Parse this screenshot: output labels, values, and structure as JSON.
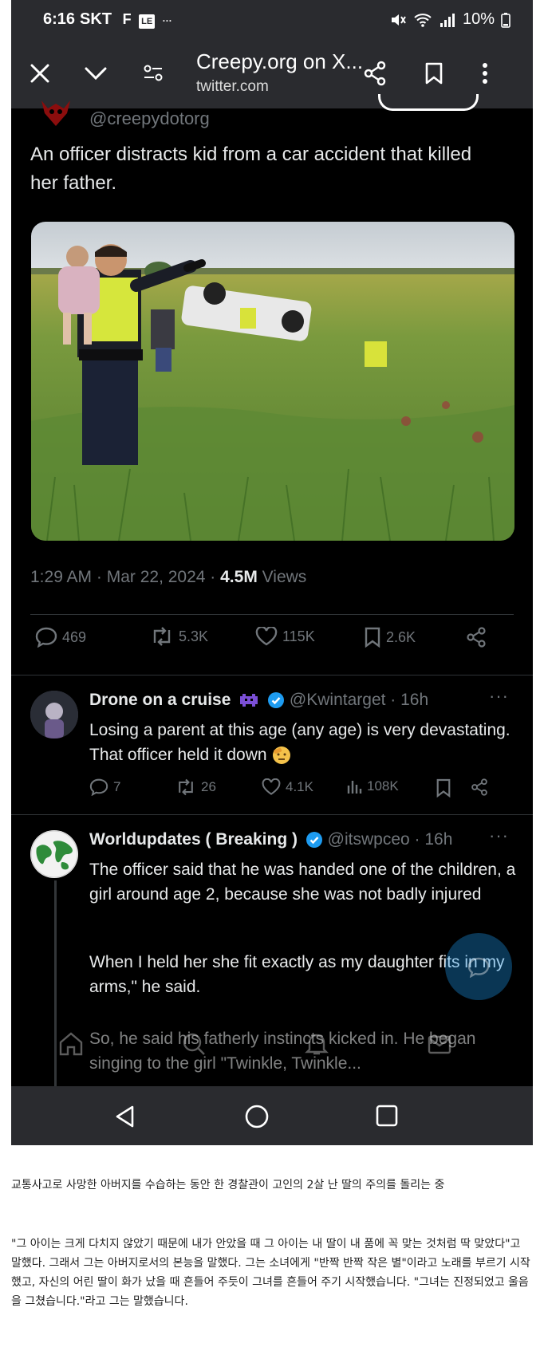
{
  "status_bar": {
    "time": "6:16",
    "carrier": "SKT",
    "battery": "10%"
  },
  "browser": {
    "title": "Creepy.org on X...",
    "domain": "twitter.com"
  },
  "tweet": {
    "handle": "@creepydotorg",
    "text": "An officer distracts kid from a car accident that killed her father.",
    "time": "1:29 AM · Mar 22, 2024 · ",
    "views_count": "4.5M",
    "views_label": " Views",
    "stats": {
      "replies": "469",
      "retweets": "5.3K",
      "likes": "115K",
      "bookmarks": "2.6K"
    }
  },
  "replies": [
    {
      "name": "Drone on a cruise",
      "handle": "@Kwintarget · 16h",
      "text": "Losing a parent at this age (any age) is very devastating. That officer held it down",
      "stats": {
        "replies": "7",
        "retweets": "26",
        "likes": "4.1K",
        "views": "108K"
      }
    },
    {
      "name": "Worldupdates ( Breaking )",
      "handle": "@itswpceo · 16h",
      "paragraphs": [
        "The officer said that he was handed one of the children, a girl around age 2, because she was not badly injured",
        "When I held her she fit exactly as my daughter fits in my arms,\" he said.",
        "So, he said his fatherly instincts kicked in. He began singing to the girl \"Twinkle, Twinkle..."
      ]
    }
  ],
  "caption": {
    "line1": "교통사고로 사망한 아버지를 수습하는 동안 한 경찰관이 고인의 2살 난 딸의 주의를 돌리는 중",
    "line2": "\"그 아이는 크게 다치지 않았기 때문에 내가 안았을 때 그 아이는 내 딸이 내 품에 꼭 맞는 것처럼 딱 맞았다\"고 말했다. 그래서 그는 아버지로서의 본능을 말했다. 그는 소녀에게 \"반짝 반짝 작은 별\"이라고 노래를 부르기 시작했고, 자신의 어린 딸이 화가 났을 때 흔들어 주듯이 그녀를 흔들어 주기 시작했습니다. \"그녀는 진정되었고 울음을 그쳤습니다.\"라고 그는 말했습니다."
  },
  "colors": {
    "accent": "#1d9bf0",
    "background": "#000000",
    "muted": "#71767b"
  }
}
